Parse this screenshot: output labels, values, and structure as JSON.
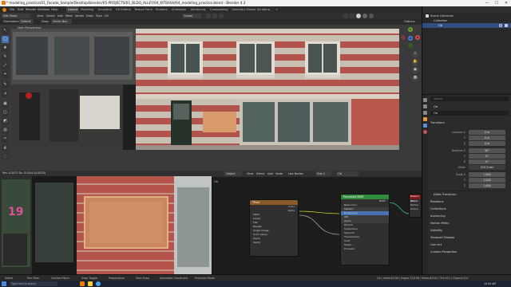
{
  "window": {
    "title": "* modeling_practice/01_Facade_Sample/Desktop/blender/05-PROJECTS/01_BLDG_ALLEY/04_KITBASH/04_modeling_practice.blend - Blender 4.3",
    "controls": [
      "—",
      "☐",
      "✕"
    ]
  },
  "menu": {
    "items": [
      "File",
      "Edit",
      "Render",
      "Window",
      "Help"
    ],
    "workspaces": [
      "Layout",
      "Modeling",
      "Sculpting",
      "UV Editing",
      "Texture Paint",
      "Shading",
      "Animation",
      "Rendering",
      "Compositing",
      "Geometry Nodes",
      "Scripting"
    ],
    "active_workspace": "Layout",
    "scene_label": "Scene",
    "view_layer_label": "ViewLayer"
  },
  "viewport_header": {
    "mode": "Edit Mode",
    "menus": [
      "View",
      "Select",
      "Add",
      "Mesh",
      "Vertex",
      "Edge",
      "Face",
      "UV"
    ],
    "transform": "Global",
    "options": "Options",
    "orientation_label": "Orientation:",
    "orientation_value": "Default",
    "drag_label": "Drag:",
    "drag_value": "Select Box"
  },
  "viewport": {
    "view_name": "User Perspective",
    "object_label": "(1) Object"
  },
  "outliner": {
    "title": "Scene Collection",
    "rows": [
      "Collection",
      "Ob"
    ]
  },
  "properties": {
    "search_placeholder": "Search",
    "object_name": "Ob",
    "field_name": "Ob",
    "transform_header": "Transform",
    "location_label": "Location X",
    "location": [
      "0 m",
      "0 m",
      "0 m"
    ],
    "rotation_label": "Rotation X",
    "rotation": [
      "90°",
      "0°",
      "0°"
    ],
    "mode_label": "Mode",
    "mode_value": "XYZ Euler",
    "scale_label": "Scale X",
    "scale": [
      "1.000",
      "1.000",
      "1.000"
    ],
    "axis_labels": [
      "Y",
      "Z"
    ],
    "panels": [
      "Delta Transform",
      "Relations",
      "Collections",
      "Instancing",
      "Motion Paths",
      "Visibility",
      "Viewport Display",
      "Line Art",
      "Custom Properties"
    ]
  },
  "image_editor": {
    "header_text": "Res: 0.0023   Dx: 0.0044 (0.0070)",
    "sign_text": "19"
  },
  "node_editor": {
    "type": "Object",
    "menus": [
      "View",
      "Select",
      "Add",
      "Node"
    ],
    "use_nodes": "Use Nodes",
    "slot": "Slot 1",
    "material": "Ob",
    "breadcrumb": "Ob",
    "image_node": {
      "title": "TP.bd",
      "rows": [
        "Color",
        "Alpha",
        "TP.bd",
        "Linear",
        "Flat",
        "Repeat",
        "Single Image",
        "Color Space",
        "sRGB",
        "Alpha",
        "Straight",
        "Vector"
      ]
    },
    "bsdf_node": {
      "title": "Principled BSDF",
      "rows": [
        "BSDF",
        "Base Color",
        "Metallic",
        "Roughness",
        "IOR",
        "Alpha",
        "Normal",
        "Subsurface",
        "Specular",
        "Transmission",
        "Coat",
        "Sheen",
        "Emission"
      ],
      "values": [
        "0.000",
        "0.500",
        "1.450",
        "1.000"
      ]
    },
    "output_node": {
      "title": "Material Output",
      "rows": [
        "All",
        "Surface",
        "Volume",
        "Displacement"
      ]
    }
  },
  "statusbar": {
    "left": [
      "Select",
      "Pan View",
      "Context Menu"
    ],
    "center": [
      "Snap Toggle",
      "Proportional",
      "Face Snap",
      "Automatic Constraint",
      "Precision Mode"
    ],
    "right": "Ob | Verts:8/156 | Edges:13/196 | Faces:6/104 | Tris:312 | Objects:1/4",
    "version": "4.3.0"
  },
  "taskbar": {
    "search_placeholder": "Type here to search",
    "clock": "10:44 AM"
  },
  "colors": {
    "accent": "#4772b3",
    "node_image": "#8a5a2b",
    "node_shader": "#2f8a3a",
    "node_output": "#7a1a1a"
  },
  "icons": [
    "cursor-icon",
    "move-icon",
    "rotate-icon",
    "scale-icon",
    "transform-icon",
    "annotate-icon",
    "measure-icon",
    "extrude-icon",
    "inset-icon",
    "bevel-icon",
    "loopcut-icon",
    "knife-icon",
    "polybuild-icon",
    "spin-icon",
    "smooth-icon",
    "edge-slide-icon",
    "shrink-icon",
    "shear-icon",
    "rip-icon"
  ]
}
